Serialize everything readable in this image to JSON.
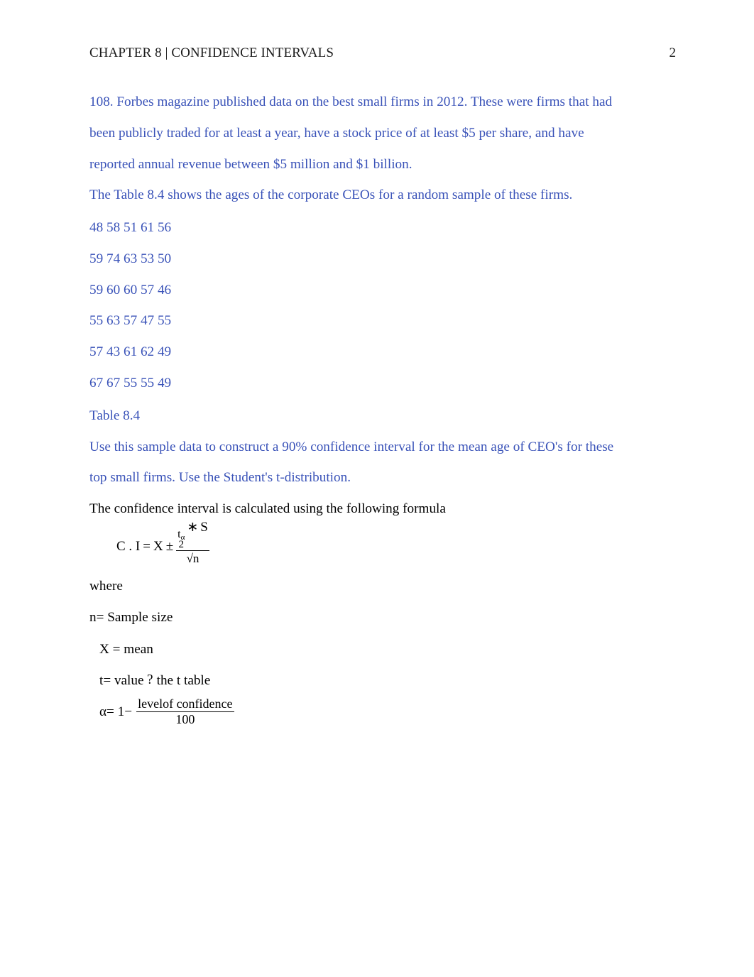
{
  "header": {
    "left": "CHAPTER 8 | CONFIDENCE INTERVALS",
    "pageNumber": "2"
  },
  "intro": {
    "p1": "108. Forbes magazine published data on the best small firms in 2012. These were firms that had",
    "p2": "been publicly traded for at least a year, have a stock price of at least $5 per share, and have",
    "p3": "reported annual revenue between $5 million and $1 billion.",
    "p4": "The Table 8.4 shows the ages of the corporate CEOs for a random sample of these firms."
  },
  "dataRows": [
    "48 58 51 61 56",
    "59 74 63 53 50",
    "59 60 60 57 46",
    "55 63 57 47 55",
    "57 43 61 62 49",
    "67 67 55 55 49"
  ],
  "tableLabel": "Table 8.4",
  "instruction": {
    "p1": "Use this sample data to construct a 90% confidence interval for the mean age of CEO's for these",
    "p2": "top small firms. Use the Student's t-distribution."
  },
  "afterFormulaLine": "The confidence interval is calculated using the following formula",
  "formula": {
    "lhs": "C . I",
    "eq": "=",
    "X": "X",
    "pm": "±",
    "t": "t",
    "alpha": "α",
    "two": "2",
    "mulStar": "∗",
    "S": "S",
    "sqrt": "√",
    "n": "n"
  },
  "defs": {
    "where": "where",
    "n": "n= Sample size",
    "x": "X = mean",
    "tPrefix": "t= value ",
    "tSuffix": " the t table",
    "invQ": "¿",
    "alphaLabel": "α= 1−",
    "alphaNum": "levelof confidence",
    "alphaDen": "100"
  }
}
